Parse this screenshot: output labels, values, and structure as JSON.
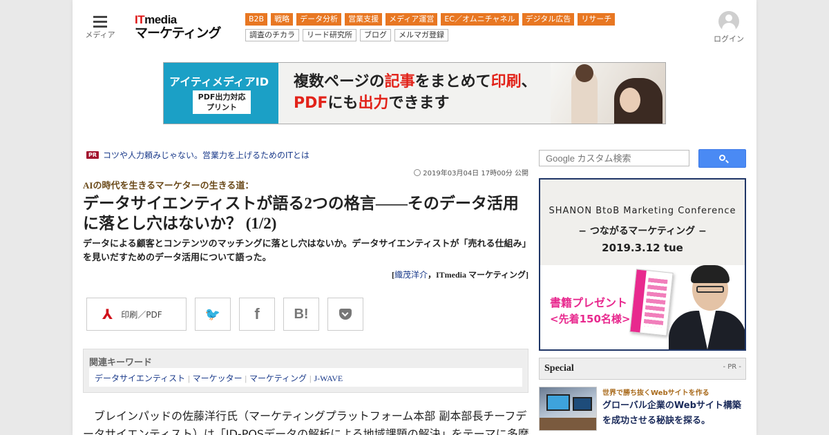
{
  "header": {
    "menu_label": "メディア",
    "logo_it": "IT",
    "logo_media": "media",
    "logo_sub": "マーケティング",
    "categories": [
      "B2B",
      "戦略",
      "データ分析",
      "営業支援",
      "メディア運営",
      "EC／オムニチャネル",
      "デジタル広告",
      "リサーチ"
    ],
    "sublinks": [
      "調査のチカラ",
      "リード研究所",
      "ブログ",
      "メルマガ登録"
    ],
    "login_label": "ログイン",
    "accent_color": "#e87722"
  },
  "banner": {
    "brand": "アイティメディアID",
    "pdf_line1": "PDF出力対応",
    "pdf_line2": "プリント",
    "line1_a": "複数ページの",
    "line1_b": "記事",
    "line1_c": "をまとめて",
    "line1_d": "印刷",
    "line1_e": "、",
    "line2_a": "PDF",
    "line2_b": "にも",
    "line2_c": "出力",
    "line2_d": "できます"
  },
  "article": {
    "pr_badge": "PR",
    "pr_text": "コツや人力頼みじゃない。営業力を上げるためのITとは",
    "pubdate": "2019年03月04日 17時00分 公開",
    "series": "AIの時代を生きるマーケターの生きる道：",
    "title": "データサイエンティストが語る2つの格言――そのデータ活用に落とし穴はないか？ (1/2)",
    "lead": "データによる顧客とコンテンツのマッチングに落とし穴はないか。データサイエンティストが「売れる仕組み」を見いだすためのデータ活用について語った。",
    "byline_open": "[",
    "byline_author": "織茂洋介",
    "byline_rest": "，ITmedia マーケティング]",
    "print_label": "印刷／PDF",
    "keywords_heading": "関連キーワード",
    "keywords": [
      "データサイエンティスト",
      "マーケッター",
      "マーケティング",
      "J-WAVE"
    ],
    "keyword_sep": "|",
    "body": "ブレインパッドの佐藤洋行氏（マーケティングプラットフォーム本部 副本部長チーフデータサイエンティスト）は「ID-POSデータの解析による地域課題の解決」をテーマに多摩"
  },
  "sidebar": {
    "search_placeholder": "Google カスタム検索",
    "ad": {
      "conference": "SHANON BtoB Marketing Conference",
      "theme": "− つながるマーケティング −",
      "date": "2019.3.12 tue",
      "present": "書籍プレゼント",
      "limit": "<先着150名様>"
    },
    "special": {
      "title": "Special",
      "pr": "- PR -",
      "item_kicker": "世界で勝ち抜くWebサイトを作る",
      "item_title": "グローバル企業のWebサイト構築を成功させる秘訣を探る。"
    }
  }
}
